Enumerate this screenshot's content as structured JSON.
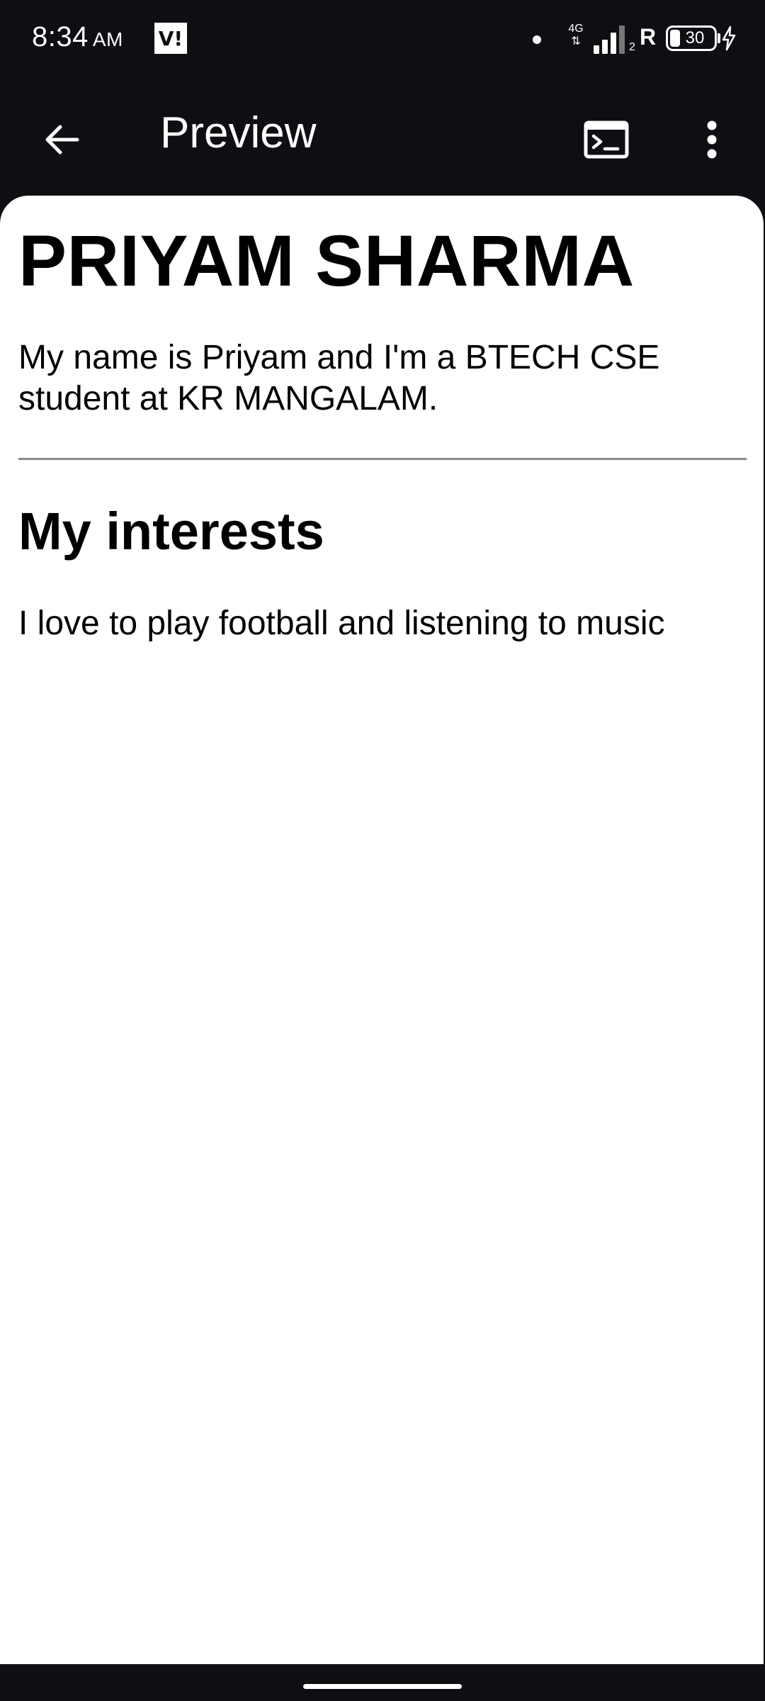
{
  "status_bar": {
    "time": "8:34",
    "ampm": "AM",
    "carrier": "V!",
    "network_type_top": "4G",
    "network_type_bottom": "⇅",
    "signal_sub": "2",
    "roaming": "R",
    "battery_level": "30",
    "icons": [
      "carrier-icon",
      "notification-dot-icon",
      "signal-icon",
      "battery-icon",
      "charging-icon"
    ]
  },
  "app_bar": {
    "title": "Preview",
    "icons": [
      "back-arrow-icon",
      "terminal-icon",
      "more-vertical-icon"
    ]
  },
  "content": {
    "heading": "PRIYAM SHARMA",
    "intro": "My name is Priyam and I'm a BTECH CSE student at KR MANGALAM.",
    "section_heading": "My interests",
    "section_text": "I love to play football and listening to music"
  },
  "colors": {
    "bar_background": "#0e0e13",
    "content_background": "#ffffff",
    "text": "#000000",
    "divider": "#8a8a8a"
  }
}
